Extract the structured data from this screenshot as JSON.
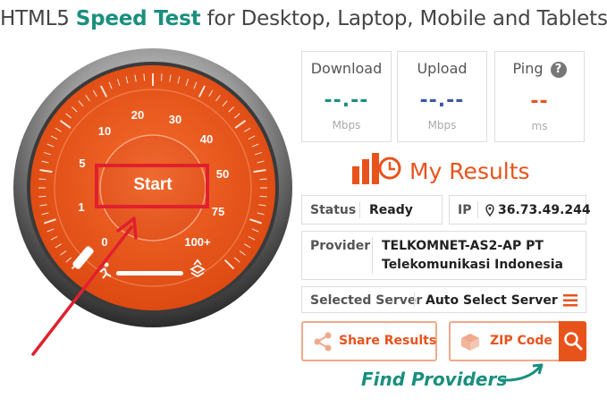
{
  "header": {
    "title_pre": "HTML5 ",
    "title_hl": "Speed Test",
    "title_post": " for Desktop, Laptop, Mobile and Tablets"
  },
  "gauge": {
    "start_label": "Start",
    "scale": [
      "0",
      "1",
      "5",
      "10",
      "20",
      "30",
      "40",
      "50",
      "75",
      "100+"
    ]
  },
  "stats": {
    "download": {
      "label": "Download",
      "value": "--.--",
      "unit": "Mbps",
      "color": "#1a8f7e"
    },
    "upload": {
      "label": "Upload",
      "value": "--.--",
      "unit": "Mbps",
      "color": "#3b56a8"
    },
    "ping": {
      "label": "Ping",
      "value": "--",
      "unit": "ms",
      "color": "#e8531c",
      "help": "?"
    }
  },
  "results": {
    "heading": "My Results",
    "status_label": "Status",
    "status_value": "Ready",
    "ip_label": "IP",
    "ip_value": "36.73.49.244",
    "provider_label": "Provider",
    "provider_line1": "TELKOMNET-AS2-AP PT",
    "provider_line2": "Telekomunikasi Indonesia",
    "server_label": "Selected Server",
    "server_value": "Auto Select Server"
  },
  "actions": {
    "share_label": "Share Results",
    "zip_label": "ZIP Code",
    "find_label": "Find Providers"
  },
  "colors": {
    "accent": "#e8531c",
    "teal": "#1a8f7e",
    "annotation": "#e0202e"
  },
  "icons": [
    "help-icon",
    "chart-clock-icon",
    "location-pin-icon",
    "menu-icon",
    "share-icon",
    "package-icon",
    "search-icon",
    "runner-icon",
    "layers-icon"
  ]
}
